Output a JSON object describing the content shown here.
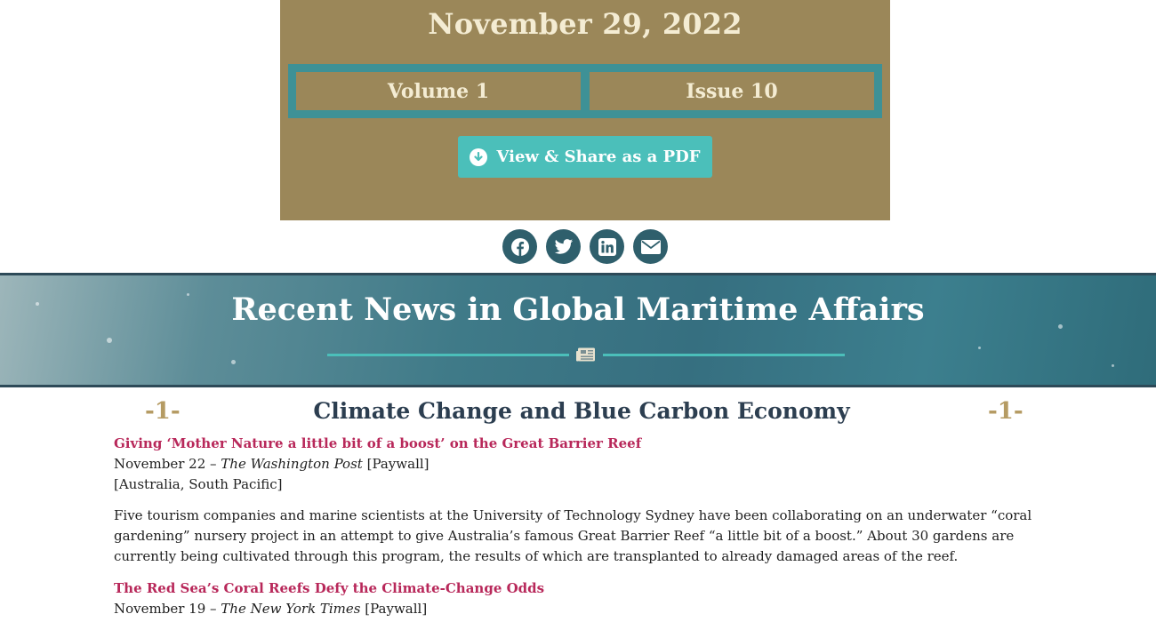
{
  "hero": {
    "date": "November 29, 2022",
    "volume": "Volume 1",
    "issue": "Issue 10",
    "pdf_button": "View & Share as a PDF",
    "pdf_icon": "download-circle-icon"
  },
  "social": {
    "icons": [
      "facebook-icon",
      "twitter-icon",
      "linkedin-icon",
      "email-icon"
    ]
  },
  "banner": {
    "title": "Recent News in Global Maritime Affairs",
    "icon": "newspaper-icon"
  },
  "section": {
    "number_left": "-1-",
    "title": "Climate Change and Blue Carbon Economy",
    "number_right": "-1-"
  },
  "articles": [
    {
      "title": "Giving ‘Mother Nature a little bit of a boost’ on the Great Barrier Reef",
      "date": "November 22 –",
      "source": "The Washington Post",
      "access": "[Paywall]",
      "region": "[Australia, South Pacific]",
      "summary": "Five tourism companies and marine scientists at the University of Technology Sydney have been collaborating on an underwater “coral gardening” nursery project in an attempt to give Australia’s famous Great Barrier Reef “a little bit of a boost.” About 30 gardens are currently being cultivated through this program, the results of which are transplanted to already damaged areas of the reef."
    },
    {
      "title": "The Red Sea’s Coral Reefs Defy the Climate-Change Odds",
      "date": "November 19 –",
      "source": "The New York Times",
      "access": "[Paywall]"
    }
  ],
  "colors": {
    "hero_bg": "#9b8759",
    "teal": "#3e9196",
    "button": "#4bbfba",
    "link": "#b8285a",
    "heading": "#2c3e50",
    "gold": "#b59b63"
  }
}
